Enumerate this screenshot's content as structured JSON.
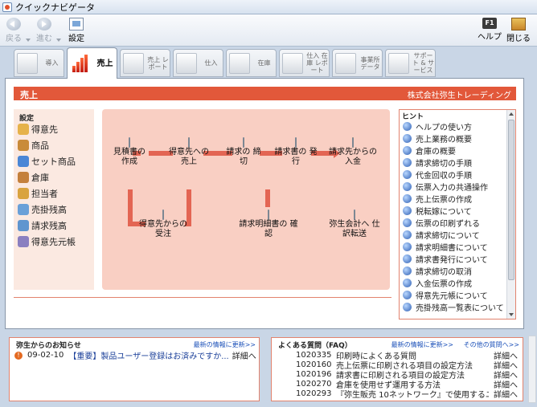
{
  "window": {
    "title": "クイックナビゲータ"
  },
  "toolbar": {
    "back": "戻る",
    "forward": "進む",
    "settings": "設定",
    "help_key": "F1",
    "help": "ヘルプ",
    "close": "閉じる"
  },
  "tabs": [
    {
      "label": "導入"
    },
    {
      "label": "売上"
    },
    {
      "label": "売上 レポート"
    },
    {
      "label": "仕入"
    },
    {
      "label": "在庫"
    },
    {
      "label": "仕入 在庫 レポート"
    },
    {
      "label": "事業所 データ"
    },
    {
      "label": "サポート & サービス"
    }
  ],
  "main": {
    "title": "売上",
    "company": "株式会社弥生トレーディング"
  },
  "settings": {
    "title": "設定",
    "items": [
      "得意先",
      "商品",
      "セット商品",
      "倉庫",
      "担当者",
      "売掛残高",
      "請求残高",
      "得意先元帳"
    ]
  },
  "flow": {
    "estimate": "見積書の 作成",
    "sales": "得意先への 売上",
    "closing": "請求の 締切",
    "invoice_issue": "請求書の 発行",
    "payment": "請求先からの 入金",
    "order": "得意先からの 受注",
    "statement": "請求明細書の 確認",
    "journal": "弥生会計へ 仕訳転送"
  },
  "hint": {
    "title": "ヒント",
    "items": [
      "ヘルプの使い方",
      "売上業務の概要",
      "倉庫の概要",
      "請求締切の手順",
      "代金回収の手順",
      "伝票入力の共通操作",
      "売上伝票の作成",
      "税転嫁について",
      "伝票の印刷ずれる",
      "請求締切について",
      "請求明細書について",
      "請求書発行について",
      "請求締切の取消",
      "入金伝票の作成",
      "得意先元帳について",
      "売掛残高一覧表について"
    ]
  },
  "news": {
    "title": "弥生からのお知らせ",
    "more": "最新の情報に更新>>",
    "items": [
      {
        "date": "09-02-10",
        "text": "【重要】製品ユーザー登録はお済みですか...",
        "link": "詳細へ"
      }
    ]
  },
  "faq": {
    "title": "よくある質問（FAQ）",
    "more": "最新の情報に更新>>",
    "other": "その他の質問へ>>",
    "items": [
      {
        "id": "1020335",
        "q": "印刷時によくある質問",
        "link": "詳細へ"
      },
      {
        "id": "1020160",
        "q": "売上伝票に印刷される項目の設定方法",
        "link": "詳細へ"
      },
      {
        "id": "1020196",
        "q": "請求書に印刷される項目の設定方法",
        "link": "詳細へ"
      },
      {
        "id": "1020270",
        "q": "倉庫を使用せず運用する方法",
        "link": "詳細へ"
      },
      {
        "id": "1020293",
        "q": "『弥生販売 10ネットワーク』で使用するユ...",
        "link": "詳細へ"
      }
    ]
  }
}
